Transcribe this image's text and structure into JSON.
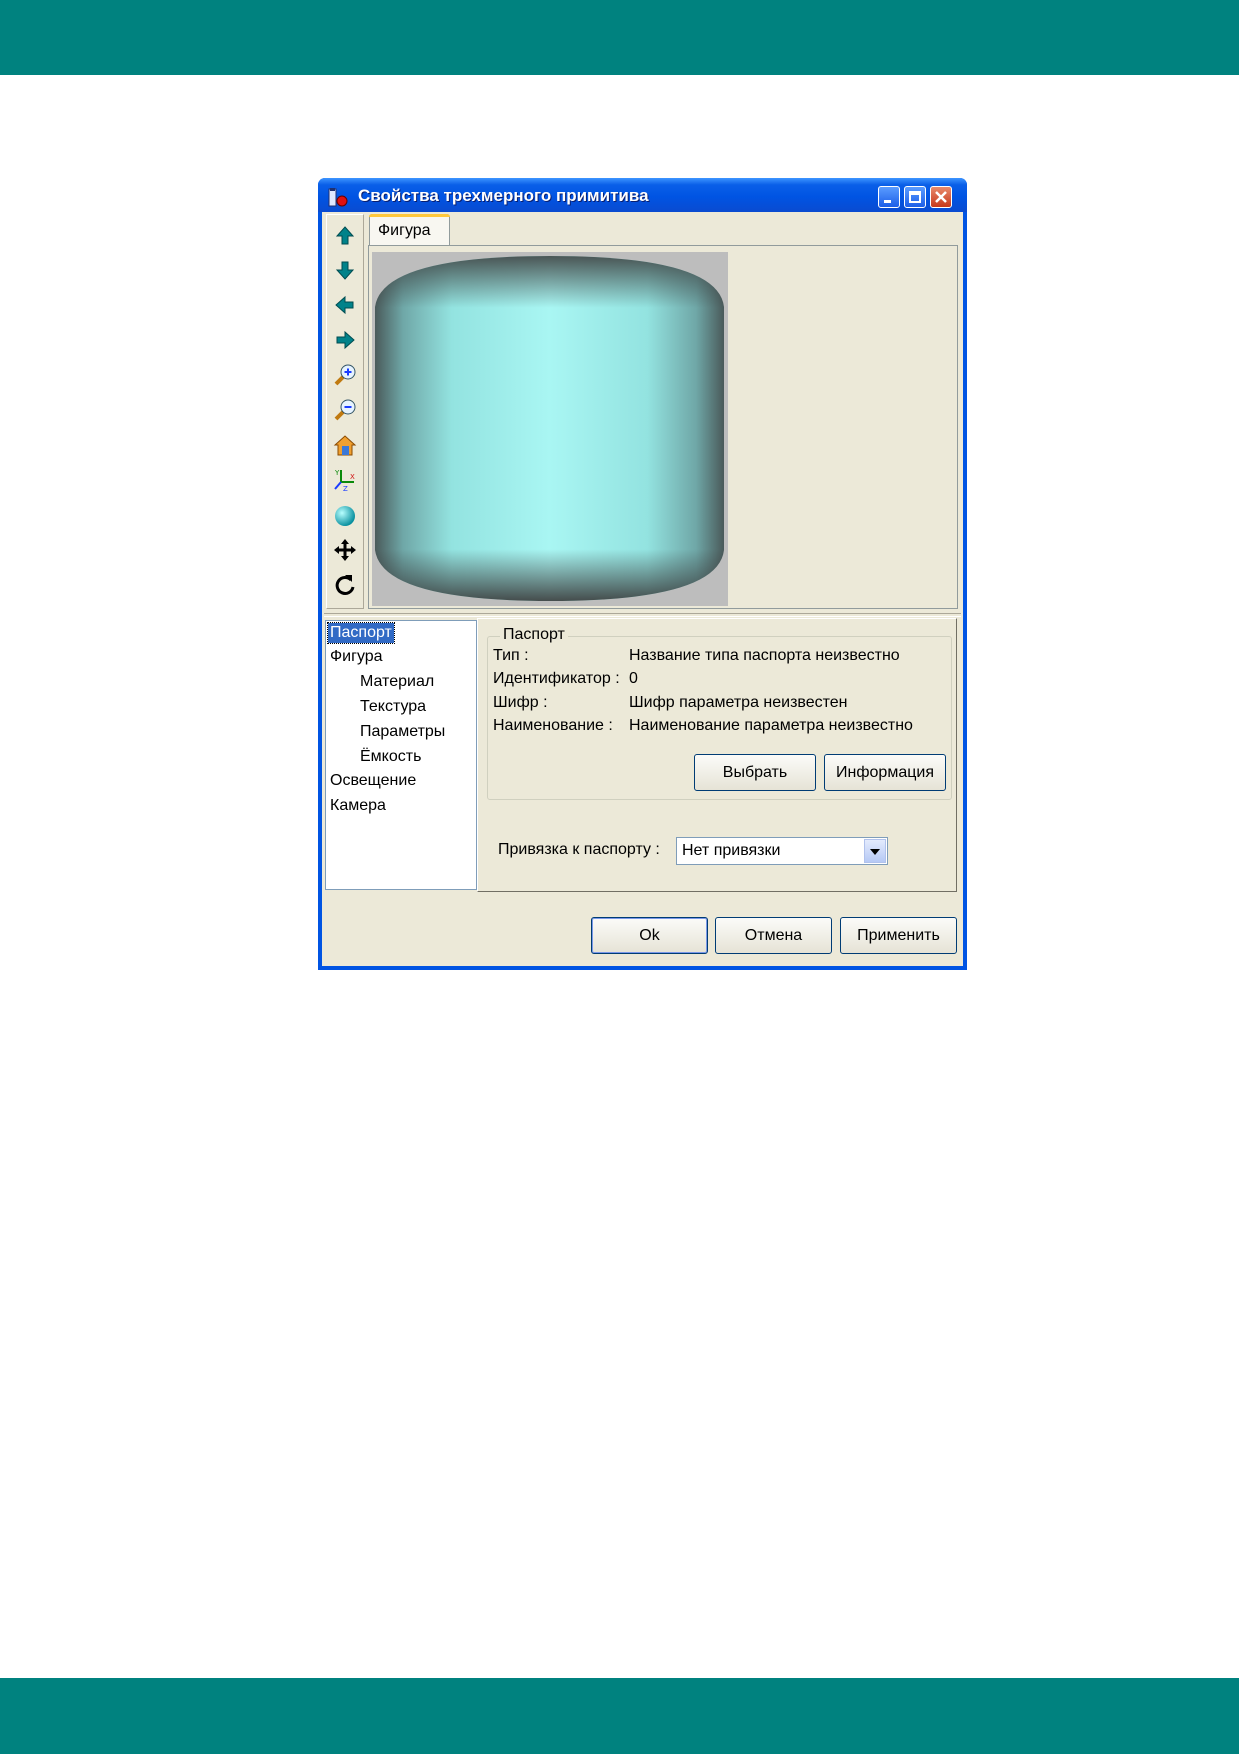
{
  "window": {
    "title": "Свойства трехмерного примитива",
    "controls": [
      "minimize",
      "maximize",
      "close"
    ]
  },
  "toolbar": {
    "tools": [
      {
        "icon": "arrow-up-icon"
      },
      {
        "icon": "arrow-down-icon"
      },
      {
        "icon": "arrow-left-icon"
      },
      {
        "icon": "arrow-right-icon"
      },
      {
        "icon": "zoom-in-icon"
      },
      {
        "icon": "zoom-out-icon"
      },
      {
        "icon": "home-view-icon"
      },
      {
        "icon": "axes-icon"
      },
      {
        "icon": "sphere-icon"
      },
      {
        "icon": "move-icon"
      },
      {
        "icon": "rotate-icon"
      }
    ]
  },
  "preview": {
    "tab_label": "Фигура",
    "shape": "cylinder",
    "shape_color": "#a8f4f1",
    "background_color": "#bdbdbd"
  },
  "tree": {
    "items": [
      {
        "label": "Паспорт",
        "level": 0,
        "selected": true
      },
      {
        "label": "Фигура",
        "level": 0
      },
      {
        "label": "Материал",
        "level": 1
      },
      {
        "label": "Текстура",
        "level": 1
      },
      {
        "label": "Параметры",
        "level": 1
      },
      {
        "label": "Ёмкость",
        "level": 1
      },
      {
        "label": "Освещение",
        "level": 0
      },
      {
        "label": "Камера",
        "level": 0
      }
    ]
  },
  "passport": {
    "group_title": "Паспорт",
    "type_label": "Тип :",
    "type_value": "Название типа паспорта неизвестно",
    "id_label": "Идентификатор :",
    "id_value": "0",
    "code_label": "Шифр :",
    "code_value": "Шифр параметра неизвестен",
    "name_label": "Наименование :",
    "name_value": "Наименование параметра неизвестно",
    "select_button": "Выбрать",
    "info_button": "Информация"
  },
  "binding": {
    "label": "Привязка к паспорту :",
    "value": "Нет привязки"
  },
  "footer": {
    "ok": "Ok",
    "cancel": "Отмена",
    "apply": "Применить"
  },
  "colors": {
    "band": "#00827f",
    "titlebar": "#0054e3",
    "dialog_bg": "#ece9d8",
    "selection": "#316ac5"
  }
}
